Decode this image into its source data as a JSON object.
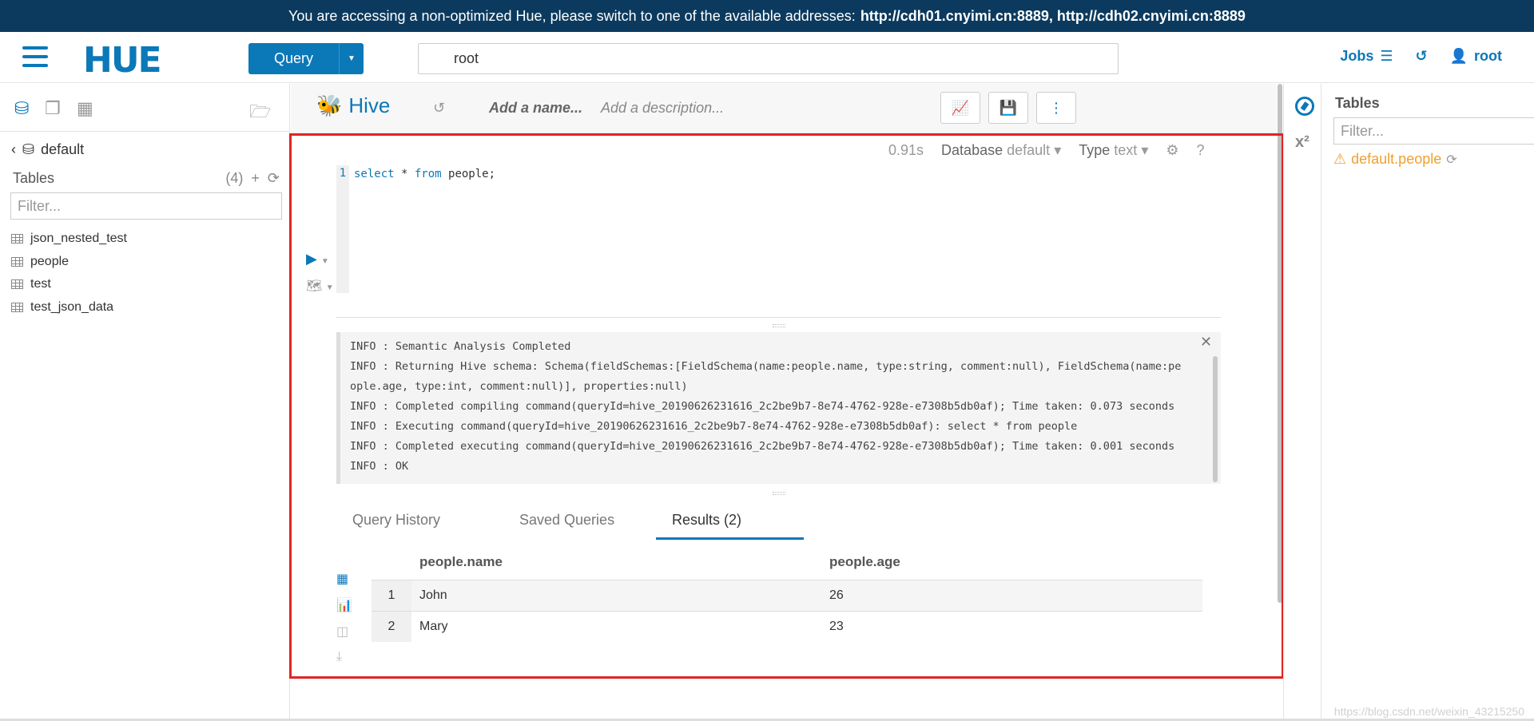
{
  "banner": {
    "text": "You are accessing a non-optimized Hue, please switch to one of the available addresses:",
    "links": "http://cdh01.cnyimi.cn:8889, http://cdh02.cnyimi.cn:8889"
  },
  "topnav": {
    "logo": "HUE",
    "query_label": "Query",
    "search_value": "root",
    "jobs_label": "Jobs",
    "user_label": "root"
  },
  "left": {
    "database": "default",
    "tables_label": "Tables",
    "tables_count": "(4)",
    "filter_placeholder": "Filter...",
    "tables": [
      "json_nested_test",
      "people",
      "test",
      "test_json_data"
    ]
  },
  "editor": {
    "engine": "Hive",
    "add_name": "Add a name...",
    "add_description": "Add a description...",
    "elapsed": "0.91s",
    "database_label": "Database",
    "database_value": "default",
    "type_label": "Type",
    "type_value": "text",
    "line_number": "1",
    "code_parts": [
      "select",
      " * ",
      "from",
      " people;"
    ]
  },
  "log": {
    "lines": [
      "INFO  : Semantic Analysis Completed",
      "INFO  : Returning Hive schema: Schema(fieldSchemas:[FieldSchema(name:people.name, type:string, comment:null), FieldSchema(name:pe",
      "ople.age, type:int, comment:null)], properties:null)",
      "INFO  : Completed compiling command(queryId=hive_20190626231616_2c2be9b7-8e74-4762-928e-e7308b5db0af); Time taken: 0.073 seconds",
      "INFO  : Executing command(queryId=hive_20190626231616_2c2be9b7-8e74-4762-928e-e7308b5db0af): select * from people",
      "INFO  : Completed executing command(queryId=hive_20190626231616_2c2be9b7-8e74-4762-928e-e7308b5db0af); Time taken: 0.001 seconds",
      "INFO  : OK"
    ]
  },
  "tabs": {
    "history": "Query History",
    "saved": "Saved Queries",
    "results": "Results (2)"
  },
  "results": {
    "columns": [
      "people.name",
      "people.age"
    ],
    "rows": [
      [
        "1",
        "John",
        "26"
      ],
      [
        "2",
        "Mary",
        "23"
      ]
    ]
  },
  "right": {
    "tables_label": "Tables",
    "filter_placeholder": "Filter...",
    "warning_table": "default.people"
  },
  "watermark": "https://blog.csdn.net/weixin_43215250",
  "colors": {
    "accent": "#0b78b8",
    "banner": "#0b3a5e",
    "highlight_box": "#e02424",
    "warning": "#f0a030"
  }
}
